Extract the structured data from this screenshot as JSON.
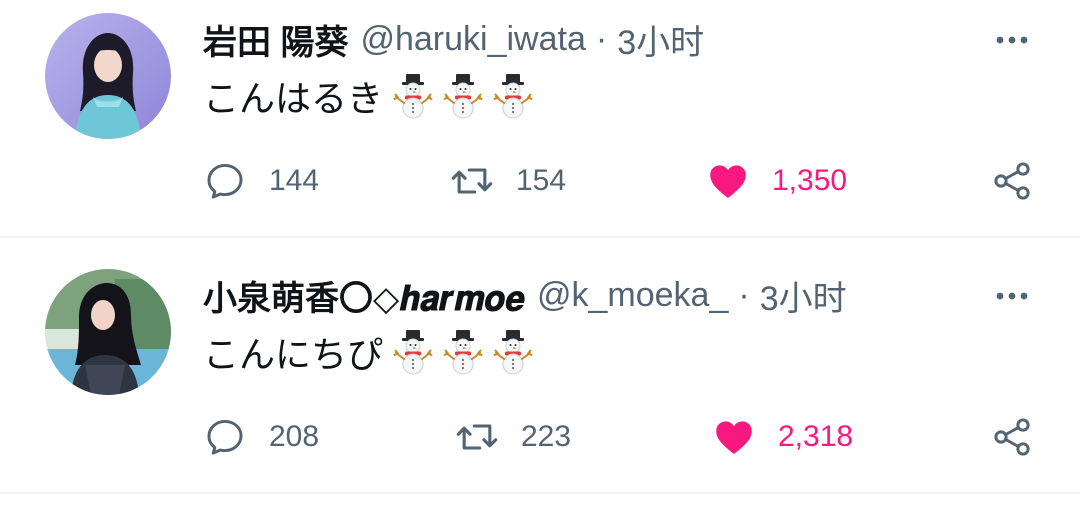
{
  "colors": {
    "text_primary": "#0f1419",
    "text_secondary": "#536471",
    "like_active": "#f91880",
    "divider": "#eff3f4"
  },
  "tweets": [
    {
      "display_name": "岩田 陽葵",
      "handle": "@haruki_iwata",
      "separator": "·",
      "time": "3小时",
      "text": "こんはるき",
      "emojis": [
        "snowman-icon",
        "snowman-icon",
        "snowman-icon"
      ],
      "actions": {
        "reply": "144",
        "retweet": "154",
        "like": "1,350",
        "like_active": true
      }
    },
    {
      "display_name": "小泉萌香〇◇𝒉𝒂𝒓𝒎𝒐𝒆",
      "handle": "@k_moeka_",
      "separator": "·",
      "time": "3小时",
      "text": "こんにちぴ",
      "emojis": [
        "snowman-icon",
        "snowman-icon",
        "snowman-icon"
      ],
      "actions": {
        "reply": "208",
        "retweet": "223",
        "like": "2,318",
        "like_active": true
      }
    }
  ]
}
